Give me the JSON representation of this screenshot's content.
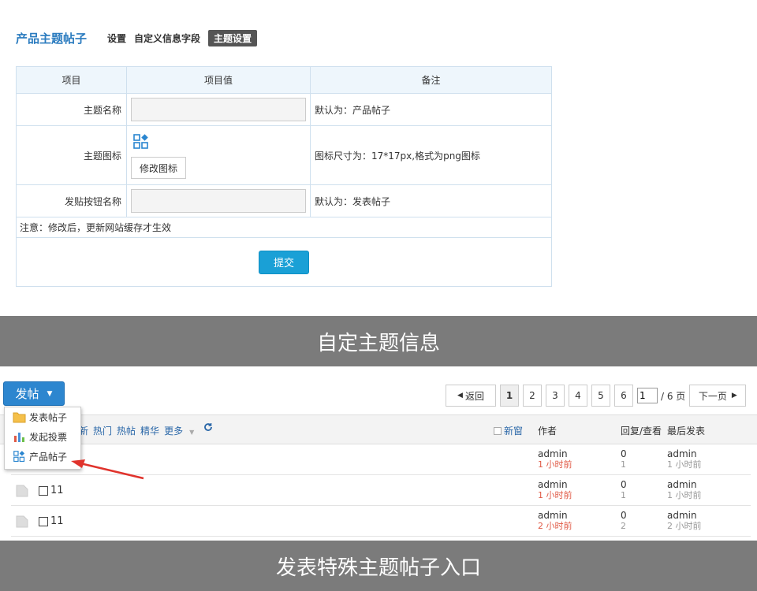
{
  "settings": {
    "nav": {
      "title": "产品主题帖子",
      "links": [
        "设置",
        "自定义信息字段",
        "主题设置"
      ]
    },
    "table": {
      "headers": [
        "项目",
        "项目值",
        "备注"
      ],
      "rows": [
        {
          "label": "主题名称",
          "value": "",
          "note": "默认为：产品帖子"
        },
        {
          "label": "主题图标",
          "button": "修改图标",
          "note": "图标尺寸为：17*17px,格式为png图标"
        },
        {
          "label": "发贴按钮名称",
          "value": "",
          "note": "默认为：发表帖子"
        }
      ],
      "notice": "注意：修改后，更新网站缓存才生效",
      "submit": "提交"
    },
    "colors": {
      "accent": "#1aa0d6",
      "active_tab": "#555555"
    }
  },
  "captions": {
    "top": "自定主题信息",
    "bottom": "发表特殊主题帖子入口"
  },
  "forum": {
    "post_button": "发帖",
    "dropdown": [
      "发表帖子",
      "发起投票",
      "产品帖子"
    ],
    "pager": {
      "prev": "返回",
      "pages": [
        "1",
        "2",
        "3",
        "4",
        "5",
        "6"
      ],
      "current": "1",
      "total": "/ 6 页",
      "next": "下一页"
    },
    "filters": [
      "新",
      "热门",
      "热帖",
      "精华",
      "更多"
    ],
    "new_window": "新窗",
    "columns": {
      "author": "作者",
      "replies": "回复/查看",
      "last": "最后发表"
    },
    "threads": [
      {
        "title": "",
        "author": "admin",
        "author_time": "1 小时前",
        "replies": "0",
        "views": "1",
        "last_user": "admin",
        "last_time": "1 小时前"
      },
      {
        "title": "11",
        "author": "admin",
        "author_time": "1 小时前",
        "replies": "0",
        "views": "1",
        "last_user": "admin",
        "last_time": "1 小时前"
      },
      {
        "title": "11",
        "author": "admin",
        "author_time": "2 小时前",
        "replies": "0",
        "views": "2",
        "last_user": "admin",
        "last_time": "2 小时前"
      }
    ]
  }
}
